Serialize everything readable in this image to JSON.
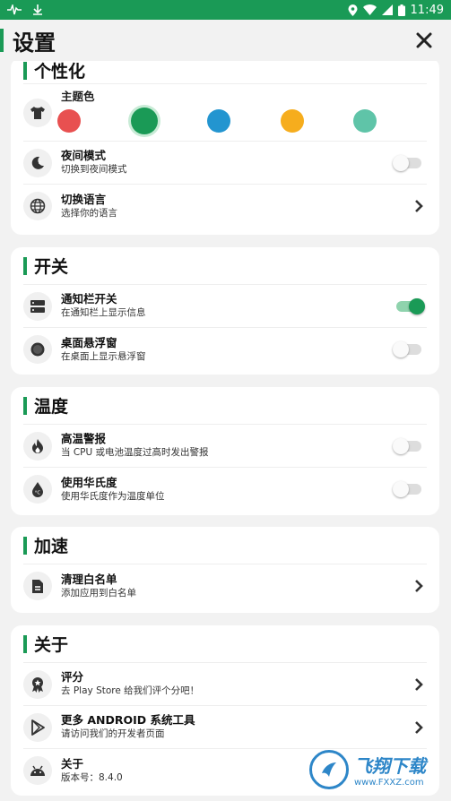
{
  "statusbar": {
    "time": "11:49"
  },
  "header": {
    "title": "设置"
  },
  "colors": {
    "accent": "#1a9a56"
  },
  "sections": {
    "personalize": {
      "title": "个性化",
      "theme_label": "主题色",
      "swatches": [
        "#e85050",
        "#1a9a56",
        "#2395d0",
        "#f6ad1d",
        "#5fc4a8"
      ],
      "night": {
        "title": "夜间模式",
        "subtitle": "切换到夜间模式",
        "on": false
      },
      "language": {
        "title": "切换语言",
        "subtitle": "选择你的语言"
      }
    },
    "switches": {
      "title": "开关",
      "notif": {
        "title": "通知栏开关",
        "subtitle": "在通知栏上显示信息",
        "on": true
      },
      "float": {
        "title": "桌面悬浮窗",
        "subtitle": "在桌面上显示悬浮窗",
        "on": false
      }
    },
    "temperature": {
      "title": "温度",
      "alarm": {
        "title": "高温警报",
        "subtitle": "当 CPU 或电池温度过高时发出警报",
        "on": false
      },
      "fahrenheit": {
        "title": "使用华氏度",
        "subtitle": "使用华氏度作为温度单位",
        "on": false
      }
    },
    "boost": {
      "title": "加速",
      "whitelist": {
        "title": "清理白名单",
        "subtitle": "添加应用到白名单"
      }
    },
    "about": {
      "title": "关于",
      "rate": {
        "title": "评分",
        "subtitle": "去 Play Store 给我们评个分吧！"
      },
      "more": {
        "title": "更多 ANDROID 系统工具",
        "subtitle": "请访问我们的开发者页面"
      },
      "info": {
        "title": "关于",
        "subtitle": "版本号：8.4.0"
      }
    }
  },
  "watermark": {
    "text": "飞翔下载",
    "url": "www.FXXZ.com"
  }
}
